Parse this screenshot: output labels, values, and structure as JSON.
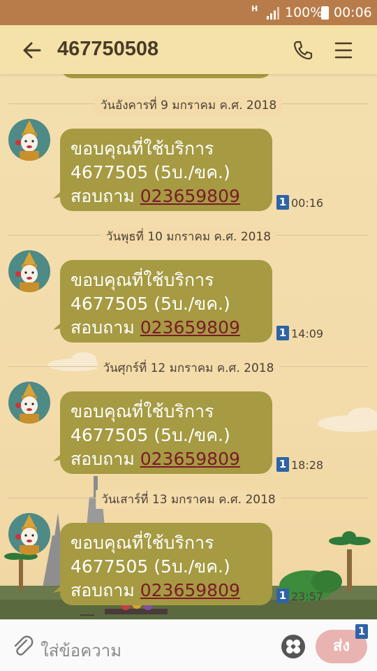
{
  "status_bar": {
    "network": "H",
    "battery": "100%",
    "time": "00:06"
  },
  "header": {
    "title": "467750508"
  },
  "conversation": {
    "date_separators": [
      "วันอังคารที่ 9 มกราคม ค.ศ. 2018",
      "วันพุธที่ 10 มกราคม ค.ศ. 2018",
      "วันศุกร์ที่ 12 มกราคม ค.ศ. 2018",
      "วันเสาร์ที่ 13 มกราคม ค.ศ. 2018"
    ],
    "messages": [
      {
        "line1": "ขอบคุณที่ใช้บริการ",
        "line2": "4677505 (5บ./ขค.)",
        "line3_prefix": "สอบถาม ",
        "phone_link": "023659809",
        "sim": "1",
        "time": "00:16"
      },
      {
        "line1": "ขอบคุณที่ใช้บริการ",
        "line2": "4677505 (5บ./ขค.)",
        "line3_prefix": "สอบถาม ",
        "phone_link": "023659809",
        "sim": "1",
        "time": "14:09"
      },
      {
        "line1": "ขอบคุณที่ใช้บริการ",
        "line2": "4677505 (5บ./ขค.)",
        "line3_prefix": "สอบถาม ",
        "phone_link": "023659809",
        "sim": "1",
        "time": "18:28"
      },
      {
        "line1": "ขอบคุณที่ใช้บริการ",
        "line2": "4677505 (5บ./ขค.)",
        "line3_prefix": "สอบถาม ",
        "phone_link": "023659809",
        "sim": "1",
        "time": "23:57"
      }
    ]
  },
  "input_bar": {
    "placeholder": "ใส่ข้อความ",
    "send_label": "ส่ง",
    "send_sim": "1"
  },
  "colors": {
    "status_bar": "#b87c4a",
    "header": "#f4e2a9",
    "bubble": "#a69a42",
    "link": "#7a1b2a",
    "sim_badge": "#2f63a5",
    "send_button": "#e8b3b1"
  },
  "icons": [
    "back-arrow-icon",
    "phone-icon",
    "menu-icon",
    "paperclip-icon",
    "sticker-icon",
    "signal-icon",
    "battery-icon"
  ]
}
